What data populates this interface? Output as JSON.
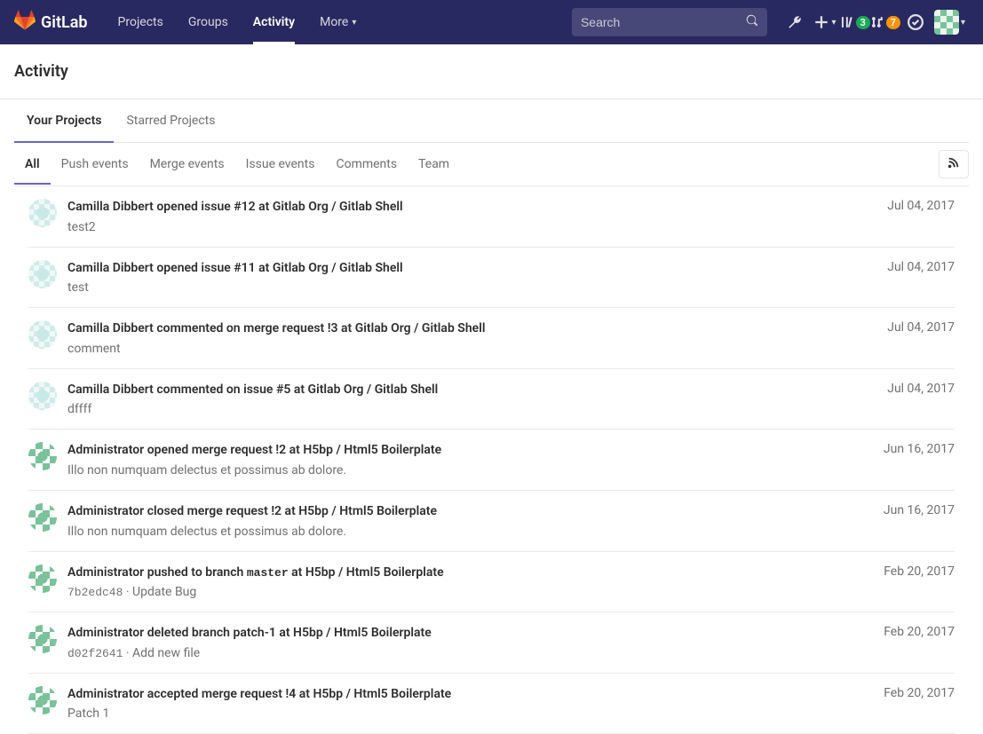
{
  "brand": "GitLab",
  "nav": {
    "projects": "Projects",
    "groups": "Groups",
    "activity": "Activity",
    "more": "More"
  },
  "search": {
    "placeholder": "Search"
  },
  "badges": {
    "issues": "3",
    "mrs": "7"
  },
  "page": {
    "title": "Activity"
  },
  "project_tabs": {
    "your": "Your Projects",
    "starred": "Starred Projects"
  },
  "filters": {
    "all": "All",
    "push": "Push events",
    "merge": "Merge events",
    "issue": "Issue events",
    "comments": "Comments",
    "team": "Team"
  },
  "events": [
    {
      "avatar": "camilla",
      "actor": "Camilla Dibbert",
      "action": "opened issue",
      "ref": "#12",
      "at": "at",
      "project": "Gitlab Org / Gitlab Shell",
      "sub": "test2",
      "date": "Jul 04, 2017"
    },
    {
      "avatar": "camilla",
      "actor": "Camilla Dibbert",
      "action": "opened issue",
      "ref": "#11",
      "at": "at",
      "project": "Gitlab Org / Gitlab Shell",
      "sub": "test",
      "date": "Jul 04, 2017"
    },
    {
      "avatar": "camilla",
      "actor": "Camilla Dibbert",
      "action": "commented on merge request",
      "ref": "!3",
      "at": "at",
      "project": "Gitlab Org / Gitlab Shell",
      "sub": "comment",
      "date": "Jul 04, 2017"
    },
    {
      "avatar": "camilla",
      "actor": "Camilla Dibbert",
      "action": "commented on issue",
      "ref": "#5",
      "at": "at",
      "project": "Gitlab Org / Gitlab Shell",
      "sub": "dffff",
      "date": "Jul 04, 2017"
    },
    {
      "avatar": "admin",
      "actor": "Administrator",
      "action": "opened merge request",
      "ref": "!2",
      "at": "at",
      "project": "H5bp / Html5 Boilerplate",
      "sub": "Illo non numquam delectus et possimus ab dolore.",
      "date": "Jun 16, 2017"
    },
    {
      "avatar": "admin",
      "actor": "Administrator",
      "action": "closed merge request",
      "ref": "!2",
      "at": "at",
      "project": "H5bp / Html5 Boilerplate",
      "sub": "Illo non numquam delectus et possimus ab dolore.",
      "date": "Jun 16, 2017"
    },
    {
      "avatar": "admin",
      "actor": "Administrator",
      "action": "pushed to branch",
      "ref_mono": "master",
      "at": "at",
      "project": "H5bp / Html5 Boilerplate",
      "sub_sha": "7b2edc48",
      "sub_sep": " · ",
      "sub_msg": "Update Bug",
      "date": "Feb 20, 2017"
    },
    {
      "avatar": "admin",
      "actor": "Administrator",
      "action": "deleted branch",
      "ref": "patch-1",
      "at": "at",
      "project": "H5bp / Html5 Boilerplate",
      "sub_sha": "d02f2641",
      "sub_sep": " · ",
      "sub_msg": "Add new file",
      "date": "Feb 20, 2017"
    },
    {
      "avatar": "admin",
      "actor": "Administrator",
      "action": "accepted merge request",
      "ref": "!4",
      "at": "at",
      "project": "H5bp / Html5 Boilerplate",
      "sub": "Patch 1",
      "date": "Feb 20, 2017"
    }
  ]
}
